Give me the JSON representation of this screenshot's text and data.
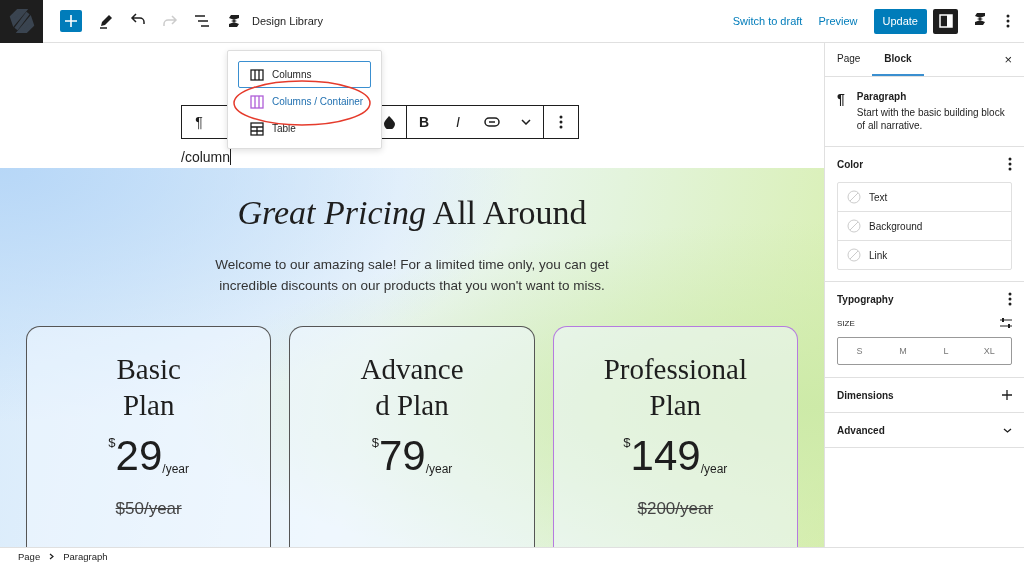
{
  "topbar": {
    "library_label": "Design Library",
    "actions": [
      {
        "label": "Switch to draft",
        "kind": "link"
      },
      {
        "label": "Preview",
        "kind": "link"
      },
      {
        "label": "Update",
        "kind": "primary"
      }
    ],
    "sidebar_toggle_on": true,
    "redo_disabled": true
  },
  "inserter_popup": {
    "items": [
      {
        "label": "Columns",
        "kind": "columns",
        "selected": true,
        "hovered": false
      },
      {
        "label": "Columns / Container",
        "kind": "container",
        "selected": false,
        "hovered": true
      },
      {
        "label": "Table",
        "kind": "table",
        "selected": false,
        "hovered": false
      }
    ]
  },
  "block_toolbar": {
    "block_glyph": "¶",
    "bold": "B",
    "italic": "I"
  },
  "editor": {
    "typed_text": "/column",
    "section": {
      "heading": "*Great Pricing* All Around",
      "intro": "Welcome to our amazing sale! For a limited time only, you can get incredible discounts on our products that you won't want to miss.",
      "plans": [
        {
          "title_lines": [
            "Basic",
            "Plan"
          ],
          "currency": "$",
          "price": "29",
          "period": "/year",
          "old_price": "$50/year",
          "selected": false
        },
        {
          "title_lines": [
            "Advance",
            "d Plan"
          ],
          "currency": "$",
          "price": "79",
          "period": "/year",
          "selected": false
        },
        {
          "title_lines": [
            "Professional",
            "Plan"
          ],
          "currency": "$",
          "price": "149",
          "period": "/year",
          "old_price": "$200/year",
          "selected": true
        }
      ]
    }
  },
  "sidebar": {
    "tabs": [
      {
        "label": "Page",
        "selected": false
      },
      {
        "label": "Block",
        "selected": true
      }
    ],
    "close_glyph": "×",
    "block": {
      "glyph": "¶",
      "name": "Paragraph",
      "description": "Start with the basic building block of all narrative."
    },
    "color": {
      "title": "Color",
      "items": [
        "Text",
        "Background",
        "Link"
      ]
    },
    "typography": {
      "title": "Typography",
      "size_label": "SIZE",
      "sizes": [
        {
          "label": "S",
          "selected": false
        },
        {
          "label": "M",
          "selected": false
        },
        {
          "label": "L",
          "selected": false
        },
        {
          "label": "XL",
          "selected": false
        }
      ]
    },
    "collapsed_panels": [
      {
        "title": "Dimensions",
        "kind": "add"
      },
      {
        "title": "Advanced",
        "kind": "expand"
      }
    ]
  },
  "status_bar": {
    "breadcrumbs": [
      "Page",
      "Paragraph"
    ]
  }
}
